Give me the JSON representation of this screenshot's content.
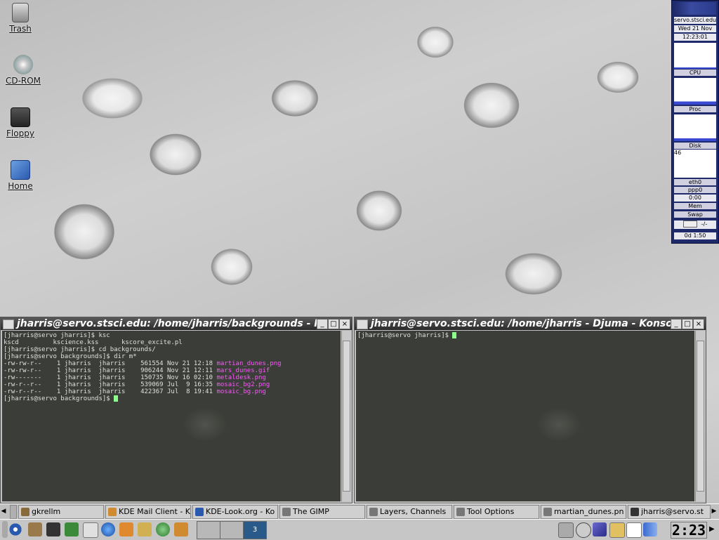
{
  "desktop_icons": [
    {
      "label": "Trash",
      "icon": "trash-icon"
    },
    {
      "label": "CD-ROM",
      "icon": "cdrom-icon"
    },
    {
      "label": "Floppy",
      "icon": "floppy-icon"
    },
    {
      "label": "Home",
      "icon": "home-icon"
    }
  ],
  "gkrellm": {
    "host": "servo.stsci.edu",
    "date": "Wed 21 Nov",
    "time": "12:23:01",
    "cpu_label": "CPU",
    "proc_label": "Proc",
    "disk_label": "Disk",
    "disk_value": "46",
    "eth_label": "eth0",
    "ppp_label": "ppp0",
    "ppp_time": "0:00",
    "mem_label": "Mem",
    "swap_label": "Swap",
    "mail_value": "-/-",
    "uptime": "0d 1:50"
  },
  "terminal_left": {
    "title": "jharris@servo.stsci.edu: /home/jharris/backgrounds - I",
    "lines": [
      {
        "text": "[jharris@servo jharris]$ ksc"
      },
      {
        "text": "kscd         ksciencе.kss      kscore_excite.pl"
      },
      {
        "text": "[jharris@servo jharris]$ cd backgrounds/"
      },
      {
        "text": "[jharris@servo backgrounds]$ dir m*"
      }
    ],
    "files": [
      {
        "perm": "-rw-rw-r--",
        "links": "1",
        "user": "jharris",
        "group": "jharris",
        "size": "561554",
        "date": "Nov 21 12:18",
        "name": "martian_dunes.png"
      },
      {
        "perm": "-rw-rw-r--",
        "links": "1",
        "user": "jharris",
        "group": "jharris",
        "size": "906244",
        "date": "Nov 21 12:11",
        "name": "mars_dunes.gif"
      },
      {
        "perm": "-rw-------",
        "links": "1",
        "user": "jharris",
        "group": "jharris",
        "size": "150735",
        "date": "Nov 16 02:10",
        "name": "metaldesk.png"
      },
      {
        "perm": "-rw-r--r--",
        "links": "1",
        "user": "jharris",
        "group": "jharris",
        "size": "539069",
        "date": "Jul  9 16:35",
        "name": "mosaic_bg2.png"
      },
      {
        "perm": "-rw-r--r--",
        "links": "1",
        "user": "jharris",
        "group": "jharris",
        "size": "422367",
        "date": "Jul  8 19:41",
        "name": "mosaic_bg.png"
      }
    ],
    "prompt": "[jharris@servo backgrounds]$ "
  },
  "terminal_right": {
    "title": "jharris@servo.stsci.edu: /home/jharris - Djuma - Konso",
    "prompt": "[jharris@servo jharris]$ "
  },
  "taskbar": [
    {
      "label": "gkrellm",
      "color": "#8a6a3a"
    },
    {
      "label": "KDE Mail Client - K",
      "color": "#d08a30"
    },
    {
      "label": "KDE-Look.org - Ko",
      "color": "#2a5ab0"
    },
    {
      "label": "The GIMP",
      "color": "#777777"
    },
    {
      "label": "Layers, Channels",
      "color": "#777777"
    },
    {
      "label": "Tool Options",
      "color": "#777777"
    },
    {
      "label": "martian_dunes.pn",
      "color": "#777777"
    },
    {
      "label": "jharris@servo.st",
      "color": "#333333"
    }
  ],
  "panel": {
    "pager_current": "3",
    "clock": "2:23",
    "colors": {
      "accent": "#1f2a6a",
      "prompt_file": "#ff55ff",
      "cursor": "#8cff8c"
    }
  }
}
